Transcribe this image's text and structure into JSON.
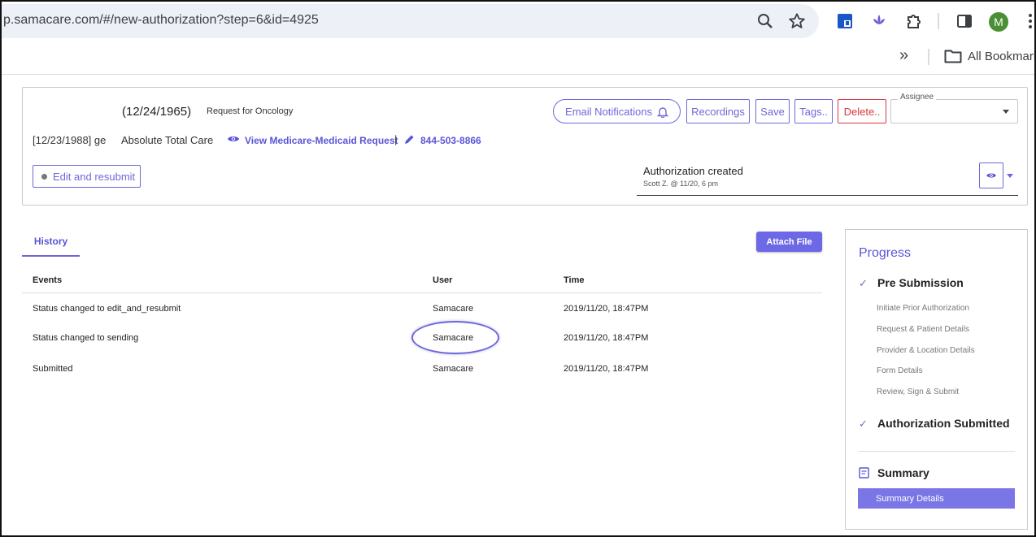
{
  "browser": {
    "url": "p.samacare.com/#/new-authorization?step=6&id=4925",
    "bookmarks_label": "All Bookmark",
    "profile_initial": "M",
    "overflow_label": "»"
  },
  "header": {
    "dob": "(12/24/1965)",
    "request_for": "Request for Oncology",
    "member_dob_line": "[12/23/1988] ge",
    "plan_name": "Absolute Total Care",
    "view_request_link": "View Medicare-Medicaid Request",
    "separator": "|",
    "phone": "844-503-8866",
    "buttons": {
      "email_notifications": "Email Notifications",
      "recordings": "Recordings",
      "save": "Save",
      "tags": "Tags..",
      "delete": "Delete.."
    },
    "assignee_label": "Assignee",
    "assignee_value": "",
    "edit_resubmit": "Edit and resubmit",
    "status_title": "Authorization created",
    "status_meta": "Scott Z. @ 11/20, 6 pm"
  },
  "history": {
    "tab_label": "History",
    "attach_label": "Attach File",
    "columns": [
      "Events",
      "User",
      "Time"
    ],
    "rows": [
      {
        "event": "Status changed to edit_and_resubmit",
        "user": "Samacare",
        "time": "2019/11/20, 18:47PM"
      },
      {
        "event": "Status changed to sending",
        "user": "Samacare",
        "time": "2019/11/20, 18:47PM"
      },
      {
        "event": "Submitted",
        "user": "Samacare",
        "time": "2019/11/20, 18:47PM"
      }
    ]
  },
  "progress": {
    "title": "Progress",
    "pre_submission": "Pre Submission",
    "substeps": [
      "Initiate Prior Authorization",
      "Request & Patient Details",
      "Provider & Location Details",
      "Form Details",
      "Review, Sign & Submit"
    ],
    "authorization_submitted": "Authorization Submitted",
    "summary": "Summary",
    "summary_details": "Summary Details"
  },
  "colors": {
    "accent": "#6d68d9",
    "danger": "#d9383c",
    "summary_bg": "#7b76e6"
  }
}
